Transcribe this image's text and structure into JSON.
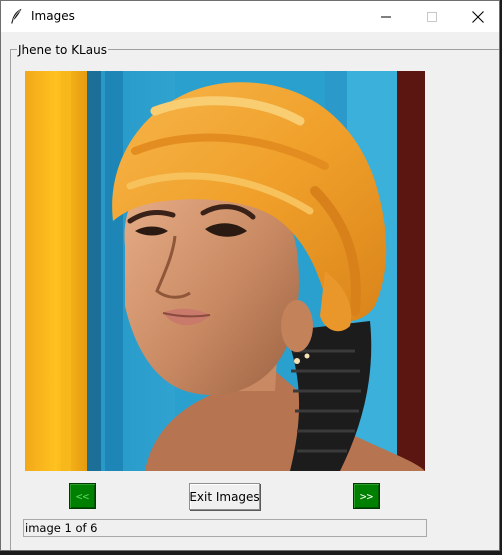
{
  "window": {
    "title": "Images",
    "icon": "feather-icon",
    "controls": [
      "minimize-icon",
      "maximize-icon",
      "close-icon"
    ]
  },
  "frame": {
    "label": "Jhene to KLaus"
  },
  "viewer": {
    "image": "portrait-photo"
  },
  "controls": {
    "prev_label": "<<",
    "exit_label": "Exit Images",
    "next_label": ">>"
  },
  "status": {
    "text": "image 1 of 6"
  },
  "colors": {
    "nav_button": "#008000",
    "window_bg": "#f0f0f0"
  }
}
